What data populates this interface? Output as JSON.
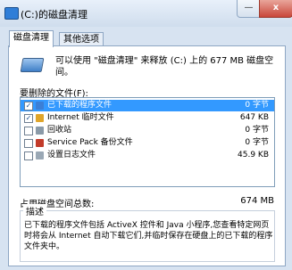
{
  "window": {
    "title": "(C:)的磁盘清理",
    "minimize_glyph": "—",
    "close_glyph": "x"
  },
  "tabs": [
    {
      "label": "磁盘清理",
      "active": true
    },
    {
      "label": "其他选项",
      "active": false
    }
  ],
  "header": {
    "text": "可以使用 \"磁盘清理\" 来释放 (C:) 上的 677 MB 磁盘空间。",
    "icon": "disk-cleanup-icon"
  },
  "files_section": {
    "label": "要删除的文件(F):",
    "items": [
      {
        "label": "已下载的程序文件",
        "size": "0 字节",
        "checked": true,
        "selected": true,
        "icon": "folder-icon",
        "icon_color": "#3b7fd6"
      },
      {
        "label": "Internet 临时文件",
        "size": "647 KB",
        "checked": true,
        "selected": false,
        "icon": "lock-folder-icon",
        "icon_color": "#e0a52a"
      },
      {
        "label": "回收站",
        "size": "0 字节",
        "checked": false,
        "selected": false,
        "icon": "recycle-bin-icon",
        "icon_color": "#8a9aa8"
      },
      {
        "label": "Service Pack 备份文件",
        "size": "0 字节",
        "checked": false,
        "selected": false,
        "icon": "backup-icon",
        "icon_color": "#c23b2a"
      },
      {
        "label": "设置日志文件",
        "size": "45.9 KB",
        "checked": false,
        "selected": false,
        "icon": "document-icon",
        "icon_color": "#9aa8b5"
      }
    ],
    "check_glyph": "✓"
  },
  "total": {
    "label": "占用磁盘空间总数:",
    "value": "674 MB"
  },
  "description": {
    "label": "描述",
    "text": "已下载的程序文件包括 ActiveX 控件和 Java 小程序,您查看特定网页时将会从 Internet 自动下载它们,并临时保存在硬盘上的已下载的程序文件夹中。"
  }
}
